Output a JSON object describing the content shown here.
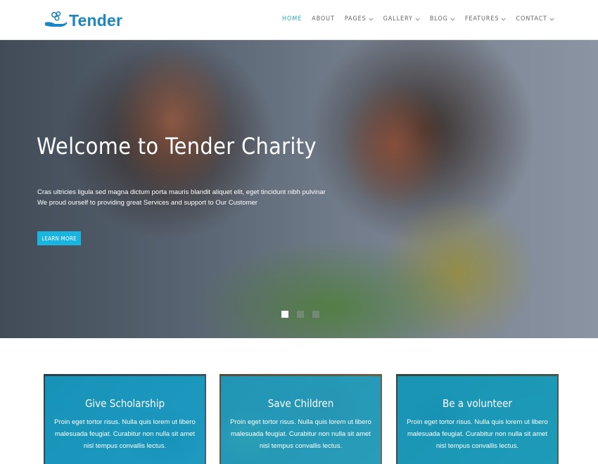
{
  "brand": {
    "name": "Tender",
    "color": "#1a86c3"
  },
  "nav": {
    "items": [
      {
        "label": "HOME",
        "dropdown": false,
        "active": true
      },
      {
        "label": "ABOUT",
        "dropdown": false,
        "active": false
      },
      {
        "label": "PAGES",
        "dropdown": true,
        "active": false
      },
      {
        "label": "GALLERY",
        "dropdown": true,
        "active": false
      },
      {
        "label": "BLOG",
        "dropdown": true,
        "active": false
      },
      {
        "label": "FEATURES",
        "dropdown": true,
        "active": false
      },
      {
        "label": "CONTACT",
        "dropdown": true,
        "active": false
      }
    ],
    "active_color": "#27a8c9"
  },
  "hero": {
    "title": "Welcome to Tender Charity",
    "text_line1": "Cras ultricies ligula sed magna dictum porta mauris blandit aliquet elit, eget tincidunt nibh pulvinar",
    "text_line2": "We proud ourself to providing great Services and support to Our Customer",
    "button_label": "LEARN MORE",
    "button_color": "#1ab4e0",
    "slides_total": 3,
    "active_slide": 1
  },
  "cards": [
    {
      "title": "Give Scholarship",
      "text_lines": [
        "Proin eget tortor risus. Nulla quis lorem ut libero",
        "malesuada feugiat. Curabitur non nulla sit amet",
        "nisl tempus convallis lectus."
      ]
    },
    {
      "title": "Save Children",
      "text_lines": [
        "Proin eget tortor risus. Nulla quis lorem ut libero",
        "malesuada feugiat. Curabitur non nulla sit amet",
        "nisl tempus convallis lectus."
      ]
    },
    {
      "title": "Be a volunteer",
      "text_lines": [
        "Proin eget tortor risus. Nulla quis lorem ut libero",
        "malesuada feugiat. Curabitur non nulla sit amet",
        "nisl tempus convallis lectus."
      ]
    }
  ],
  "card_overlay_color": "#12aad7"
}
